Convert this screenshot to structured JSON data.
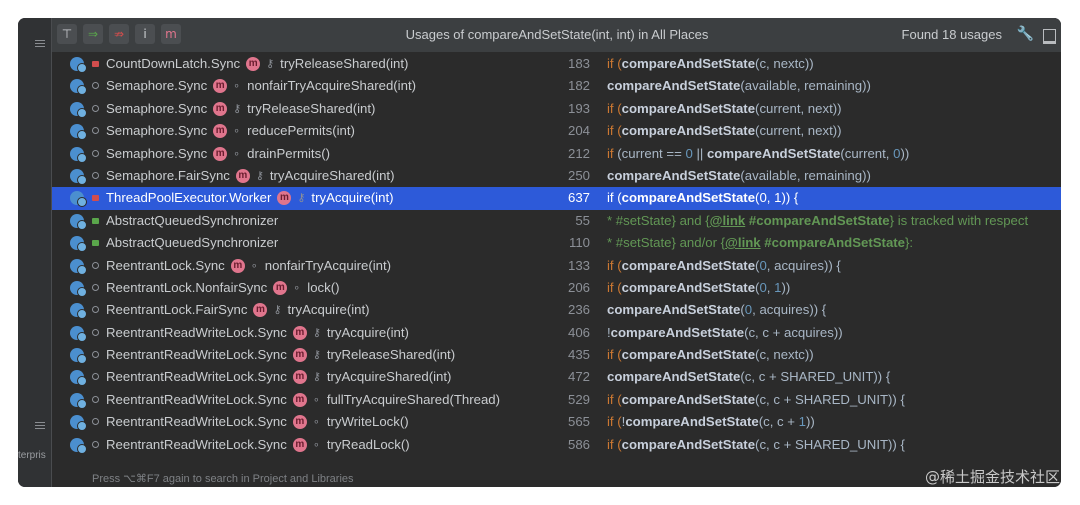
{
  "header": {
    "title": "Usages of compareAndSetState(int, int) in All Places",
    "found": "Found 18 usages",
    "toolbar": [
      "⊤",
      "⇒",
      "⇏",
      "i",
      "m"
    ]
  },
  "left_strip_text": "terpris",
  "footer": "Press ⌥⌘F7 again to search in Project and Libraries",
  "watermark": "@稀土掘金技术社区",
  "rows": [
    {
      "mod": "lk",
      "cls": "CountDownLatch.Sync",
      "acc": "key",
      "meth": "tryReleaseShared(int)",
      "ln": "183",
      "code": [
        [
          "kw",
          "if ("
        ],
        [
          "fn",
          "compareAndSetState"
        ],
        [
          "p",
          "(c, nextc))"
        ]
      ]
    },
    {
      "mod": "o",
      "cls": "Semaphore.Sync",
      "acc": "o",
      "meth": "nonfairTryAcquireShared(int)",
      "ln": "182",
      "code": [
        [
          "fn",
          "compareAndSetState"
        ],
        [
          "p",
          "(available, remaining))"
        ]
      ]
    },
    {
      "mod": "o",
      "cls": "Semaphore.Sync",
      "acc": "key",
      "meth": "tryReleaseShared(int)",
      "ln": "193",
      "code": [
        [
          "kw",
          "if ("
        ],
        [
          "fn",
          "compareAndSetState"
        ],
        [
          "p",
          "(current, next))"
        ]
      ]
    },
    {
      "mod": "o",
      "cls": "Semaphore.Sync",
      "acc": "o",
      "meth": "reducePermits(int)",
      "ln": "204",
      "code": [
        [
          "kw",
          "if ("
        ],
        [
          "fn",
          "compareAndSetState"
        ],
        [
          "p",
          "(current, next))"
        ]
      ]
    },
    {
      "mod": "o",
      "cls": "Semaphore.Sync",
      "acc": "o",
      "meth": "drainPermits()",
      "ln": "212",
      "code": [
        [
          "kw",
          "if "
        ],
        [
          "p",
          "(current == "
        ],
        [
          "num",
          "0"
        ],
        [
          "p",
          " || "
        ],
        [
          "fn",
          "compareAndSetState"
        ],
        [
          "p",
          "(current, "
        ],
        [
          "num",
          "0"
        ],
        [
          "p",
          "))"
        ]
      ]
    },
    {
      "mod": "o",
      "cls": "Semaphore.FairSync",
      "acc": "key",
      "meth": "tryAcquireShared(int)",
      "ln": "250",
      "code": [
        [
          "fn",
          "compareAndSetState"
        ],
        [
          "p",
          "(available, remaining))"
        ]
      ]
    },
    {
      "mod": "lk",
      "cls": "ThreadPoolExecutor.Worker",
      "acc": "key",
      "meth": "tryAcquire(int)",
      "ln": "637",
      "sel": true,
      "code": [
        [
          "kw",
          "if ("
        ],
        [
          "fn",
          "compareAndSetState"
        ],
        [
          "p",
          "("
        ],
        [
          "num",
          "0"
        ],
        [
          "p",
          ", "
        ],
        [
          "num",
          "1"
        ],
        [
          "p",
          ")) {"
        ]
      ]
    },
    {
      "mod": "unlk",
      "cls": "AbstractQueuedSynchronizer",
      "acc": "",
      "meth": "",
      "ln": "55",
      "code": [
        [
          "cm",
          "* #setState} and {"
        ],
        [
          "lnk",
          "@link"
        ],
        [
          "cm",
          " "
        ],
        [
          "cmb",
          "#compareAndSetState"
        ],
        [
          "cm",
          "} is tracked with respect"
        ]
      ]
    },
    {
      "mod": "unlk",
      "cls": "AbstractQueuedSynchronizer",
      "acc": "",
      "meth": "",
      "ln": "110",
      "code": [
        [
          "cm",
          "* #setState} and/or {"
        ],
        [
          "lnk",
          "@link"
        ],
        [
          "cm",
          " "
        ],
        [
          "cmb",
          "#compareAndSetState"
        ],
        [
          "cm",
          "}:"
        ]
      ]
    },
    {
      "mod": "o",
      "cls": "ReentrantLock.Sync",
      "acc": "o",
      "meth": "nonfairTryAcquire(int)",
      "ln": "133",
      "code": [
        [
          "kw",
          "if ("
        ],
        [
          "fn",
          "compareAndSetState"
        ],
        [
          "p",
          "("
        ],
        [
          "num",
          "0"
        ],
        [
          "p",
          ", acquires)) {"
        ]
      ]
    },
    {
      "mod": "o",
      "cls": "ReentrantLock.NonfairSync",
      "acc": "o",
      "meth": "lock()",
      "ln": "206",
      "code": [
        [
          "kw",
          "if ("
        ],
        [
          "fn",
          "compareAndSetState"
        ],
        [
          "p",
          "("
        ],
        [
          "num",
          "0"
        ],
        [
          "p",
          ", "
        ],
        [
          "num",
          "1"
        ],
        [
          "p",
          "))"
        ]
      ]
    },
    {
      "mod": "o",
      "cls": "ReentrantLock.FairSync",
      "acc": "key",
      "meth": "tryAcquire(int)",
      "ln": "236",
      "code": [
        [
          "fn",
          "compareAndSetState"
        ],
        [
          "p",
          "("
        ],
        [
          "num",
          "0"
        ],
        [
          "p",
          ", acquires)) {"
        ]
      ]
    },
    {
      "mod": "o",
      "cls": "ReentrantReadWriteLock.Sync",
      "acc": "key",
      "meth": "tryAcquire(int)",
      "ln": "406",
      "code": [
        [
          "p",
          "!"
        ],
        [
          "fn",
          "compareAndSetState"
        ],
        [
          "p",
          "(c, c + acquires))"
        ]
      ]
    },
    {
      "mod": "o",
      "cls": "ReentrantReadWriteLock.Sync",
      "acc": "key",
      "meth": "tryReleaseShared(int)",
      "ln": "435",
      "code": [
        [
          "kw",
          "if ("
        ],
        [
          "fn",
          "compareAndSetState"
        ],
        [
          "p",
          "(c, nextc))"
        ]
      ]
    },
    {
      "mod": "o",
      "cls": "ReentrantReadWriteLock.Sync",
      "acc": "key",
      "meth": "tryAcquireShared(int)",
      "ln": "472",
      "code": [
        [
          "fn",
          "compareAndSetState"
        ],
        [
          "p",
          "(c, c + SHARED_UNIT)) {"
        ]
      ]
    },
    {
      "mod": "o",
      "cls": "ReentrantReadWriteLock.Sync",
      "acc": "o",
      "meth": "fullTryAcquireShared(Thread)",
      "ln": "529",
      "code": [
        [
          "kw",
          "if ("
        ],
        [
          "fn",
          "compareAndSetState"
        ],
        [
          "p",
          "(c, c + SHARED_UNIT)) {"
        ]
      ]
    },
    {
      "mod": "o",
      "cls": "ReentrantReadWriteLock.Sync",
      "acc": "o",
      "meth": "tryWriteLock()",
      "ln": "565",
      "code": [
        [
          "kw",
          "if ("
        ],
        [
          "p",
          "!"
        ],
        [
          "fn",
          "compareAndSetState"
        ],
        [
          "p",
          "(c, c + "
        ],
        [
          "num",
          "1"
        ],
        [
          "p",
          "))"
        ]
      ]
    },
    {
      "mod": "o",
      "cls": "ReentrantReadWriteLock.Sync",
      "acc": "o",
      "meth": "tryReadLock()",
      "ln": "586",
      "code": [
        [
          "kw",
          "if ("
        ],
        [
          "fn",
          "compareAndSetState"
        ],
        [
          "p",
          "(c, c + SHARED_UNIT)) {"
        ]
      ]
    }
  ]
}
